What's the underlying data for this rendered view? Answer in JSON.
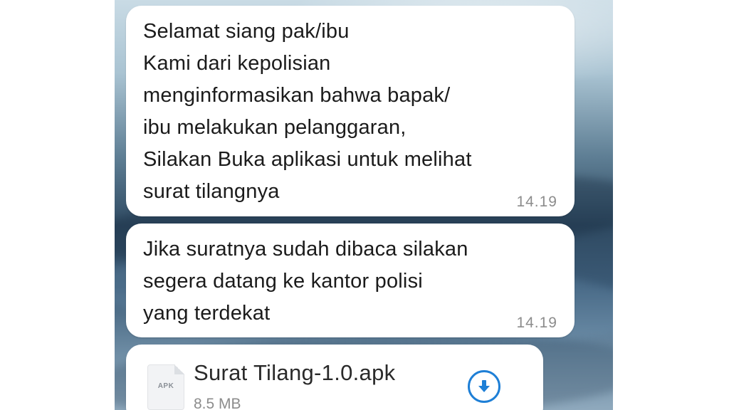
{
  "messages": [
    {
      "text": "Selamat siang pak/ibu\nKami dari kepolisian\nmenginformasikan bahwa bapak/\nibu melakukan pelanggaran,\nSilakan Buka aplikasi untuk melihat\nsurat tilangnya",
      "time": "14.19"
    },
    {
      "text": "Jika suratnya sudah dibaca silakan\nsegera datang ke kantor polisi\nyang terdekat",
      "time": "14.19"
    }
  ],
  "attachment": {
    "icon": "apk-file-icon",
    "icon_label": "APK",
    "file_name": "Surat Tilang-1.0.apk",
    "file_size": "8.5 MB",
    "download_icon": "download-icon"
  },
  "colors": {
    "accent": "#1e7fd6",
    "bubble": "#ffffff",
    "timestamp": "#8c8c8c"
  }
}
